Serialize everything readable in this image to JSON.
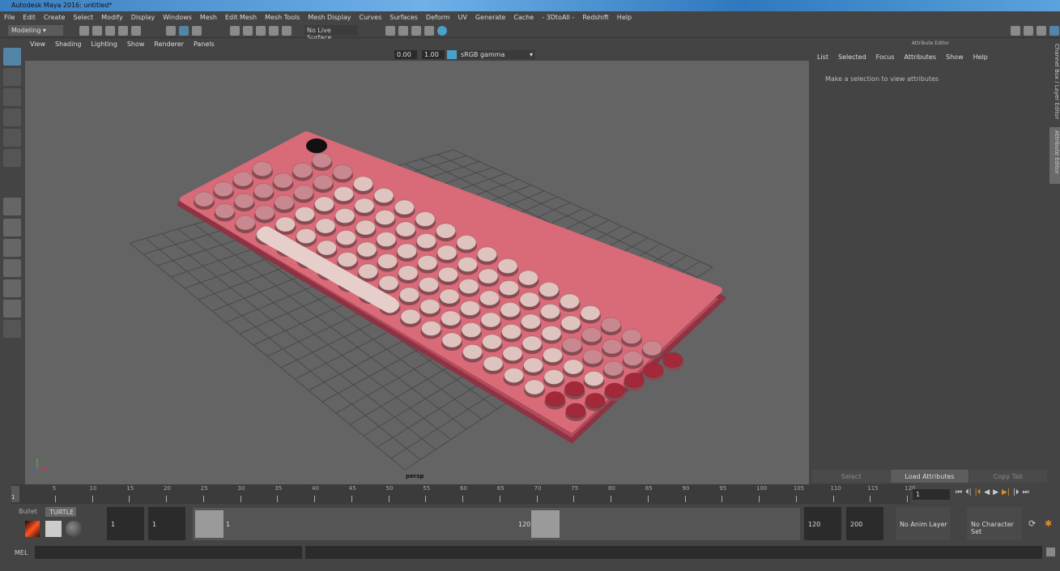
{
  "window": {
    "title": "Autodesk Maya 2016: untitled*"
  },
  "menubar": [
    "File",
    "Edit",
    "Create",
    "Select",
    "Modify",
    "Display",
    "Windows",
    "Mesh",
    "Edit Mesh",
    "Mesh Tools",
    "Mesh Display",
    "Curves",
    "Surfaces",
    "Deform",
    "UV",
    "Generate",
    "Cache",
    "- 3DtoAll -",
    "Redshift",
    "Help"
  ],
  "statusline": {
    "menu_set": "Modeling",
    "live_surface": "No Live Surface"
  },
  "viewport": {
    "menu": [
      "View",
      "Shading",
      "Lighting",
      "Show",
      "Renderer",
      "Panels"
    ],
    "exposure": "0.00",
    "gamma": "1.00",
    "color_space": "sRGB gamma",
    "camera": "persp"
  },
  "attribute_editor": {
    "title": "Attribute Editor",
    "menu": [
      "List",
      "Selected",
      "Focus",
      "Attributes",
      "Show",
      "Help"
    ],
    "message": "Make a selection to view attributes",
    "buttons": [
      "Select",
      "Load Attributes",
      "Copy Tab"
    ],
    "side_tabs": [
      "Channel Box / Layer Editor",
      "Attribute Editor"
    ]
  },
  "timeline": {
    "ticks": [
      "5",
      "10",
      "15",
      "20",
      "25",
      "30",
      "35",
      "40",
      "45",
      "50",
      "55",
      "60",
      "65",
      "70",
      "75",
      "80",
      "85",
      "90",
      "95",
      "100",
      "105",
      "110",
      "115",
      "120"
    ],
    "start_marker": "1",
    "current_frame": "1"
  },
  "range": {
    "shelf_tabs": [
      "Bullet",
      "TURTLE"
    ],
    "start_time": "1",
    "playback_start": "1",
    "range_start_label": "1",
    "range_end_label": "120",
    "playback_end": "120",
    "end_time": "200",
    "anim_layer": "No Anim Layer",
    "character_set": "No Character Set"
  },
  "commandline": {
    "label": "MEL"
  },
  "colors": {
    "accent": "#5285a6",
    "key_light": "#dfc3bf",
    "key_pink": "#c98890",
    "key_red": "#a3293a",
    "base": "#d96a78"
  }
}
